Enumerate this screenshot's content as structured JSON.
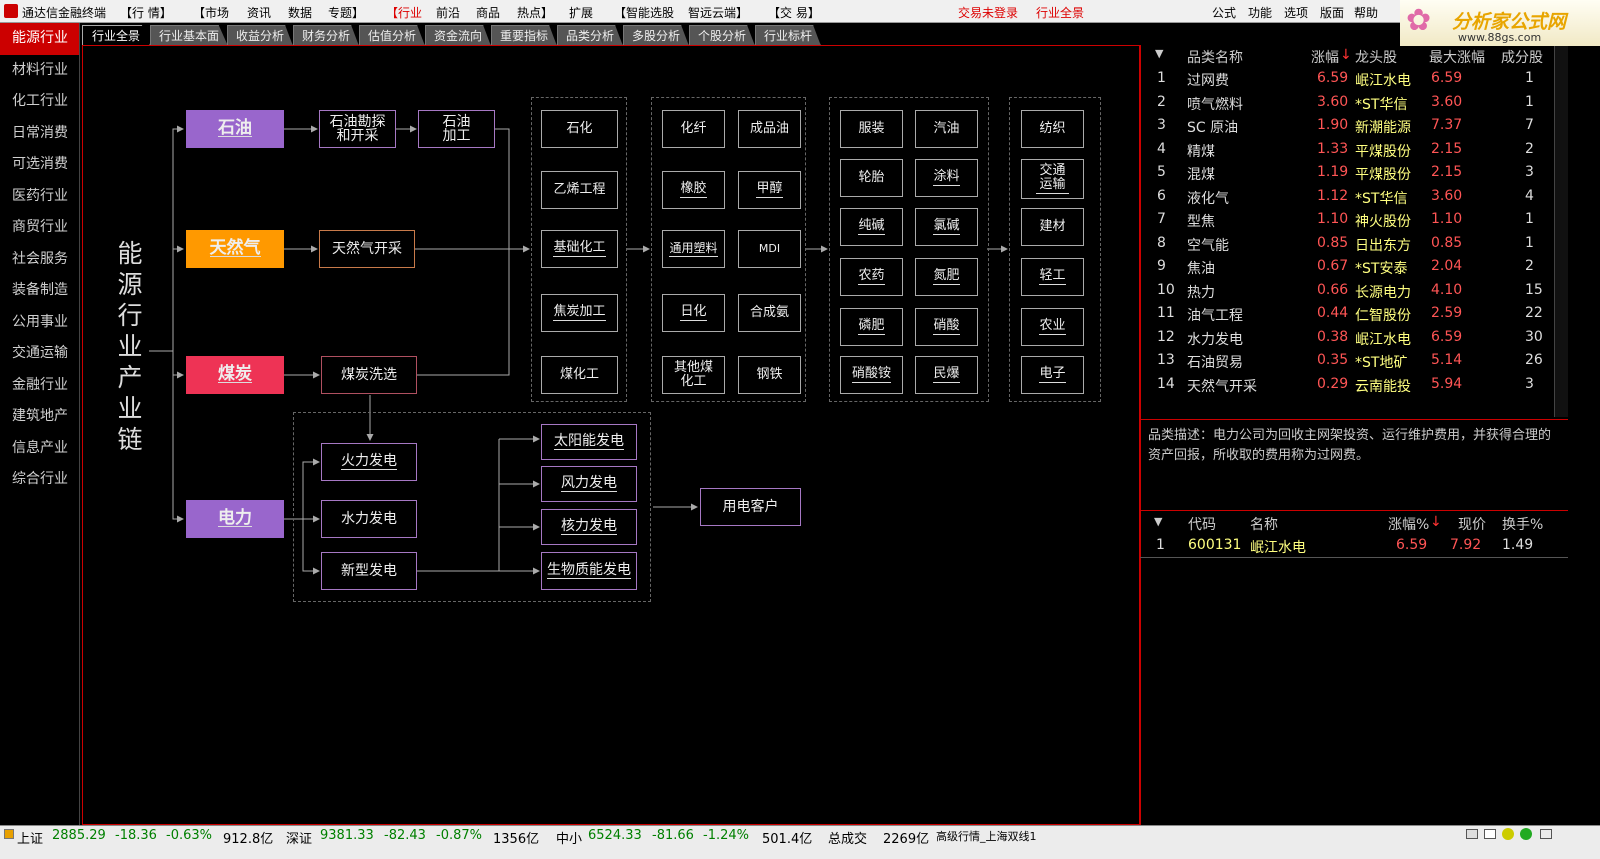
{
  "menubar": {
    "title": "通达信金融终端",
    "items": [
      "【行 情】",
      "【市场",
      "资讯",
      "数据",
      "专题】",
      "【行业",
      "前沿",
      "商品",
      "热点】",
      "扩展",
      "【智能选股",
      "智远云端】",
      "【交 易】"
    ],
    "status": [
      "交易未登录",
      "行业全景"
    ],
    "right": [
      "公式",
      "功能",
      "选项",
      "版面",
      "帮助"
    ]
  },
  "brand": {
    "name": "分析家公式网",
    "url": "www.88gs.com"
  },
  "sidebar": {
    "items": [
      "能源行业",
      "材料行业",
      "化工行业",
      "日常消费",
      "可选消费",
      "医药行业",
      "商贸行业",
      "社会服务",
      "装备制造",
      "公用事业",
      "交通运输",
      "金融行业",
      "建筑地产",
      "信息产业",
      "综合行业"
    ]
  },
  "tabs": [
    "行业全景",
    "行业基本面",
    "收益分析",
    "财务分析",
    "估值分析",
    "资金流向",
    "重要指标",
    "品类分析",
    "多股分析",
    "个股分析",
    "行业标杆"
  ],
  "chain": {
    "title": "能源行业产业链",
    "categories": [
      {
        "label": "石油",
        "color": "#9966cc"
      },
      {
        "label": "天然气",
        "color": "#ff9900"
      },
      {
        "label": "煤炭",
        "color": "#ee3355"
      },
      {
        "label": "电力",
        "color": "#9966cc"
      }
    ],
    "oil": [
      "石油勘探和开采",
      "石油加工"
    ],
    "gas": "天然气开采",
    "coal": "煤炭洗选",
    "power": [
      "火力发电",
      "水力发电",
      "新型发电"
    ],
    "new_power": [
      "太阳能发电",
      "风力发电",
      "核力发电",
      "生物质能发电"
    ],
    "customer": "用电客户",
    "g1": [
      "石化",
      "乙烯工程",
      "基础化工",
      "焦炭加工",
      "煤化工"
    ],
    "g2": [
      "化纤",
      "成品油",
      "橡胶",
      "甲醇",
      "通用塑料",
      "MDI",
      "日化",
      "合成氨",
      "其他煤化工",
      "钢铁"
    ],
    "g3": [
      "服装",
      "汽油",
      "轮胎",
      "涂料",
      "纯碱",
      "氯碱",
      "农药",
      "氮肥",
      "磷肥",
      "硝酸",
      "硝酸铵",
      "民爆"
    ],
    "g4": [
      "纺织",
      "交通运输",
      "建材",
      "轻工",
      "农业",
      "电子"
    ]
  },
  "ranking": {
    "headers": [
      "品类名称",
      "涨幅",
      "龙头股",
      "最大涨幅",
      "成分股"
    ],
    "rows": [
      [
        "1",
        "过网费",
        "6.59",
        "岷江水电",
        "6.59",
        "1"
      ],
      [
        "2",
        "喷气燃料",
        "3.60",
        "*ST华信",
        "3.60",
        "1"
      ],
      [
        "3",
        "SC 原油",
        "1.90",
        "新潮能源",
        "7.37",
        "7"
      ],
      [
        "4",
        "精煤",
        "1.33",
        "平煤股份",
        "2.15",
        "2"
      ],
      [
        "5",
        "混煤",
        "1.19",
        "平煤股份",
        "2.15",
        "3"
      ],
      [
        "6",
        "液化气",
        "1.12",
        "*ST华信",
        "3.60",
        "4"
      ],
      [
        "7",
        "型焦",
        "1.10",
        "神火股份",
        "1.10",
        "1"
      ],
      [
        "8",
        "空气能",
        "0.85",
        "日出东方",
        "0.85",
        "1"
      ],
      [
        "9",
        "焦油",
        "0.67",
        "*ST安泰",
        "2.04",
        "2"
      ],
      [
        "10",
        "热力",
        "0.66",
        "长源电力",
        "4.10",
        "15"
      ],
      [
        "11",
        "油气工程",
        "0.44",
        "仁智股份",
        "2.59",
        "22"
      ],
      [
        "12",
        "水力发电",
        "0.38",
        "岷江水电",
        "6.59",
        "30"
      ],
      [
        "13",
        "石油贸易",
        "0.35",
        "*ST地矿",
        "5.14",
        "26"
      ],
      [
        "14",
        "天然气开采",
        "0.29",
        "云南能投",
        "5.94",
        "3"
      ]
    ]
  },
  "description": "品类描述：电力公司为回收主网架投资、运行维护费用，并获得合理的资产回报，所收取的费用称为过网费。",
  "stocks": {
    "headers": [
      "代码",
      "名称",
      "涨幅%",
      "现价",
      "换手%"
    ],
    "rows": [
      [
        "1",
        "600131",
        "岷江水电",
        "6.59",
        "7.92",
        "1.49"
      ]
    ]
  },
  "statusbar": {
    "sh": {
      "label": "上证",
      "value": "2885.29",
      "change": "-18.36",
      "pct": "-0.63%",
      "amount": "912.8亿"
    },
    "sz": {
      "label": "深证",
      "value": "9381.33",
      "change": "-82.43",
      "pct": "-0.87%",
      "amount": "1356亿"
    },
    "zx": {
      "label": "中小",
      "value": "6524.33",
      "change": "-81.66",
      "pct": "-1.24%",
      "amount": "501.4亿"
    },
    "total": {
      "label": "总成交",
      "value": "2269亿"
    },
    "feed": "高级行情_上海双线1"
  }
}
